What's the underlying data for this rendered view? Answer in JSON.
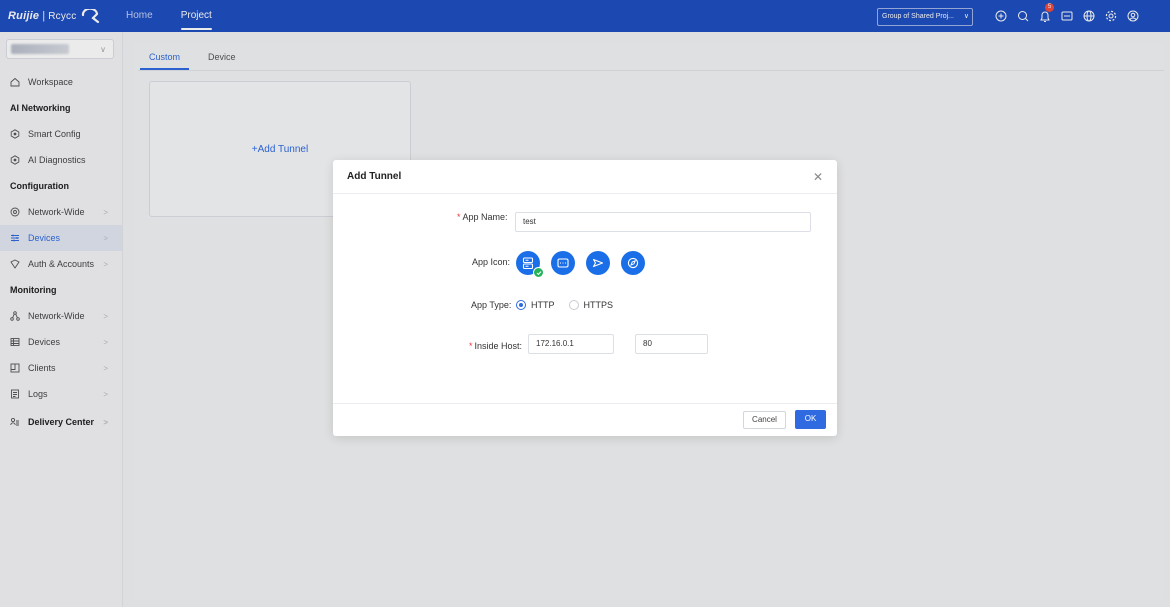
{
  "topbar": {
    "brand": "Ruijie",
    "brand_sub": "Rcycc",
    "tabs": [
      {
        "label": "Home",
        "active": false
      },
      {
        "label": "Project",
        "active": true
      }
    ],
    "group_select": "Group of Shared Proj...",
    "notification_count": "5",
    "icons": [
      "add-circle-icon",
      "search-icon",
      "bell-icon",
      "message-icon",
      "globe-icon",
      "settings-icon",
      "user-icon"
    ],
    "color": "#1f4fc1"
  },
  "sidebar": {
    "workspace": "Workspace",
    "section_ai": "AI Networking",
    "smart_config": "Smart Config",
    "ai_diagnostics": "AI Diagnostics",
    "section_config": "Configuration",
    "config_network_wide": "Network-Wide",
    "config_devices": "Devices",
    "auth_accounts": "Auth & Accounts",
    "section_monitoring": "Monitoring",
    "mon_network_wide": "Network-Wide",
    "mon_devices": "Devices",
    "clients": "Clients",
    "logs": "Logs",
    "delivery_center": "Delivery Center"
  },
  "main": {
    "tabs": [
      {
        "label": "Custom",
        "active": true
      },
      {
        "label": "Device",
        "active": false
      }
    ],
    "add_tunnel": "+Add Tunnel"
  },
  "modal": {
    "title": "Add Tunnel",
    "app_name_label": "App Name:",
    "app_name_value": "test",
    "app_icon_label": "App Icon:",
    "app_icons": [
      "server-icon",
      "terminal-icon",
      "send-icon",
      "compass-icon"
    ],
    "selected_icon": "server-icon",
    "app_type_label": "App Type:",
    "app_type_options": [
      {
        "label": "HTTP",
        "selected": true
      },
      {
        "label": "HTTPS",
        "selected": false
      }
    ],
    "inside_host_label": "Inside Host:",
    "inside_host_ip": "172.16.0.1",
    "inside_host_port": "80",
    "cancel_label": "Cancel",
    "ok_label": "OK",
    "accent": "#2f6ae0"
  }
}
